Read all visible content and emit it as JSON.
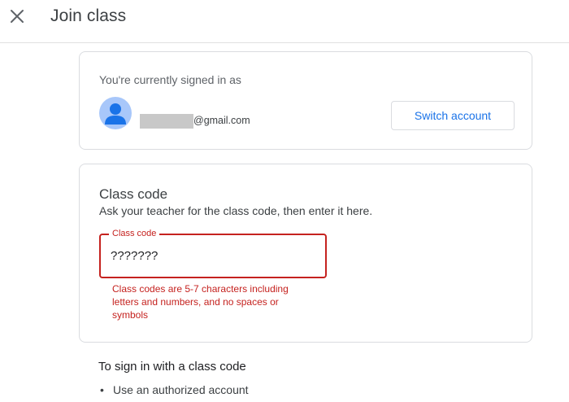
{
  "header": {
    "title": "Join class",
    "close_icon": "close-icon"
  },
  "account": {
    "signed_in_label": "You're currently signed in as",
    "email_domain": "@gmail.com",
    "switch_label": "Switch account",
    "avatar_icon": "person-icon",
    "avatar_color": "#a8c7fa"
  },
  "class_code": {
    "heading": "Class code",
    "help": "Ask your teacher for the class code, then enter it here.",
    "field_label": "Class code",
    "value": "???????",
    "error": "Class codes are 5-7 characters including letters and numbers, and no spaces or symbols",
    "error_color": "#c5221f"
  },
  "signin_help": {
    "heading": "To sign in with a class code",
    "items": [
      "Use an authorized account"
    ]
  },
  "colors": {
    "accent": "#1a73e8"
  }
}
